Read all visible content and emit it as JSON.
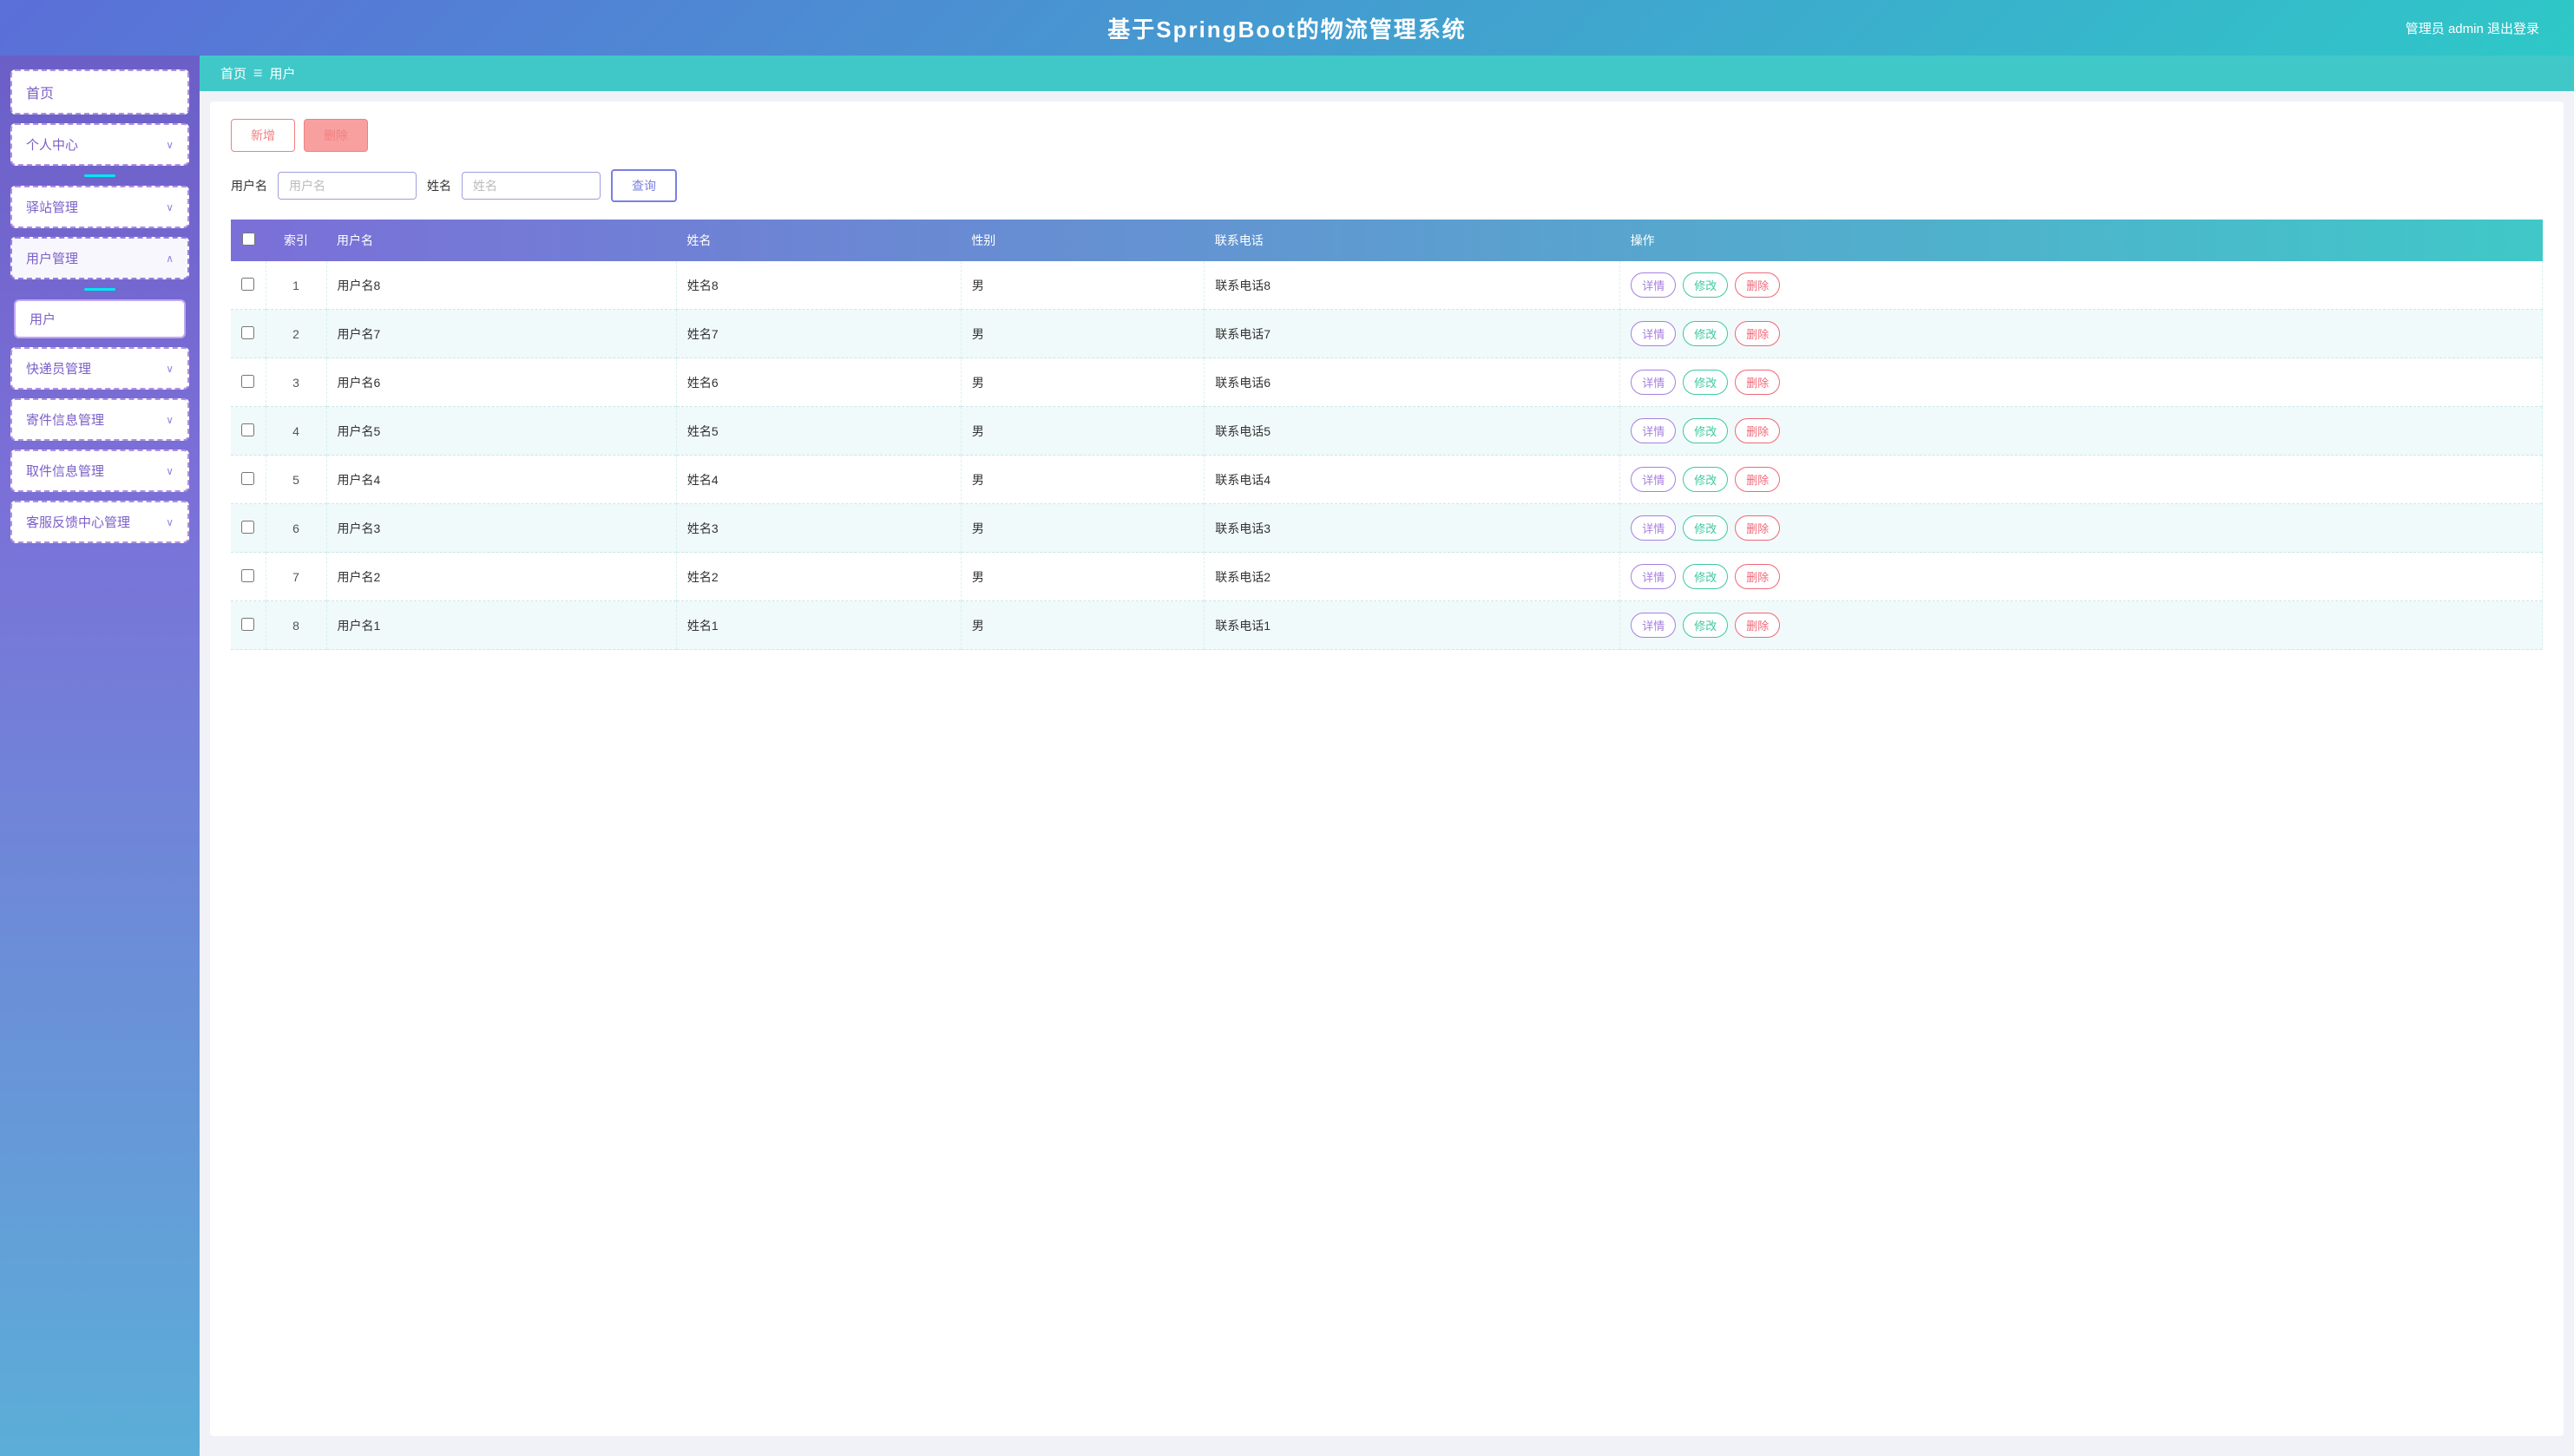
{
  "header": {
    "title": "基于SpringBoot的物流管理系统",
    "user_info": "管理员 admin  退出登录"
  },
  "breadcrumb": {
    "home": "首页",
    "sep": "≡",
    "current": "用户"
  },
  "action_buttons": {
    "add": "新增",
    "delete": "删除"
  },
  "search": {
    "username_label": "用户名",
    "username_placeholder": "用户名",
    "name_label": "姓名",
    "name_placeholder": "姓名",
    "query_btn": "查询"
  },
  "table": {
    "columns": [
      "索引",
      "用户名",
      "姓名",
      "性别",
      "联系电话",
      "操作"
    ],
    "rows": [
      {
        "index": 1,
        "username": "用户名8",
        "name": "姓名8",
        "gender": "男",
        "phone": "联系电话8"
      },
      {
        "index": 2,
        "username": "用户名7",
        "name": "姓名7",
        "gender": "男",
        "phone": "联系电话7"
      },
      {
        "index": 3,
        "username": "用户名6",
        "name": "姓名6",
        "gender": "男",
        "phone": "联系电话6"
      },
      {
        "index": 4,
        "username": "用户名5",
        "name": "姓名5",
        "gender": "男",
        "phone": "联系电话5"
      },
      {
        "index": 5,
        "username": "用户名4",
        "name": "姓名4",
        "gender": "男",
        "phone": "联系电话4"
      },
      {
        "index": 6,
        "username": "用户名3",
        "name": "姓名3",
        "gender": "男",
        "phone": "联系电话3"
      },
      {
        "index": 7,
        "username": "用户名2",
        "name": "姓名2",
        "gender": "男",
        "phone": "联系电话2"
      },
      {
        "index": 8,
        "username": "用户名1",
        "name": "姓名1",
        "gender": "男",
        "phone": "联系电话1"
      }
    ],
    "ops": {
      "detail": "详情",
      "edit": "修改",
      "delete": "删除"
    }
  },
  "sidebar": {
    "items": [
      {
        "label": "首页",
        "key": "home",
        "has_chevron": false,
        "active": false
      },
      {
        "label": "个人中心",
        "key": "profile",
        "has_chevron": true,
        "active": false
      },
      {
        "label": "驿站管理",
        "key": "station",
        "has_chevron": true,
        "active": false
      },
      {
        "label": "用户管理",
        "key": "user-mgmt",
        "has_chevron": true,
        "active": true
      },
      {
        "label": "用户",
        "key": "user",
        "has_chevron": false,
        "active": true,
        "is_sub": true
      },
      {
        "label": "快递员管理",
        "key": "courier",
        "has_chevron": true,
        "active": false
      },
      {
        "label": "寄件信息管理",
        "key": "ship-info",
        "has_chevron": true,
        "active": false
      },
      {
        "label": "取件信息管理",
        "key": "pickup-info",
        "has_chevron": true,
        "active": false
      },
      {
        "label": "客服反馈中心管理",
        "key": "feedback",
        "has_chevron": true,
        "active": false
      }
    ]
  }
}
